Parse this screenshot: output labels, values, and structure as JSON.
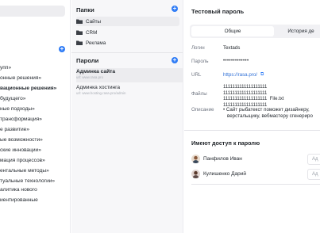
{
  "ideas": [
    "упп»",
    "онные решения»",
    "вационные решения»",
    "будущего»",
    "ные подходы»",
    "трансформация»",
    "е развитие»",
    "ые возможности»",
    "ские инновации»",
    "мация процессов»",
    "ентальные методы»",
    "туальные технологии»",
    "алитика нового",
    "иентированные"
  ],
  "folders_title": "Папки",
  "folders": [
    "Сайты",
    "CRM",
    "Реклама"
  ],
  "passwords_title": "Пароли",
  "passwords": [
    {
      "name": "Админка сайта",
      "url": "url: www.rasa.pro"
    },
    {
      "name": "Админка хостинга",
      "url": "url: www.hosting.rasa.pro/admin"
    }
  ],
  "detail": {
    "title": "Тестовый пароль",
    "tab_general": "Общие",
    "tab_history": "История де",
    "login_label": "Логин",
    "login_value": "Textads",
    "password_label": "Пароль",
    "password_value": "•••••••••••••",
    "url_label": "URL",
    "url_value": "https://rasa.pro/",
    "files_label": "Файлы",
    "file_line1": "1111111111111111111",
    "file_line2": "1111111111111111111",
    "file_line3": "1111111111111111111",
    "file_line3_name": "File.txt",
    "file_line4": "1111111111111111111",
    "desc_label": "Описание",
    "desc_line1": "• Сайт рыбатекст поможет дизайнеру,",
    "desc_line2": "верстальщику, вебмастеру сгенериро",
    "access_title": "Имеют доступ к паролю",
    "people": [
      {
        "name": "Панфилов Иван",
        "role": "Ад"
      },
      {
        "name": "Кулишенко Дарий",
        "role": "Ад"
      }
    ]
  },
  "colors": {
    "accent": "#2f7cf6",
    "link": "#2f6fd6"
  }
}
